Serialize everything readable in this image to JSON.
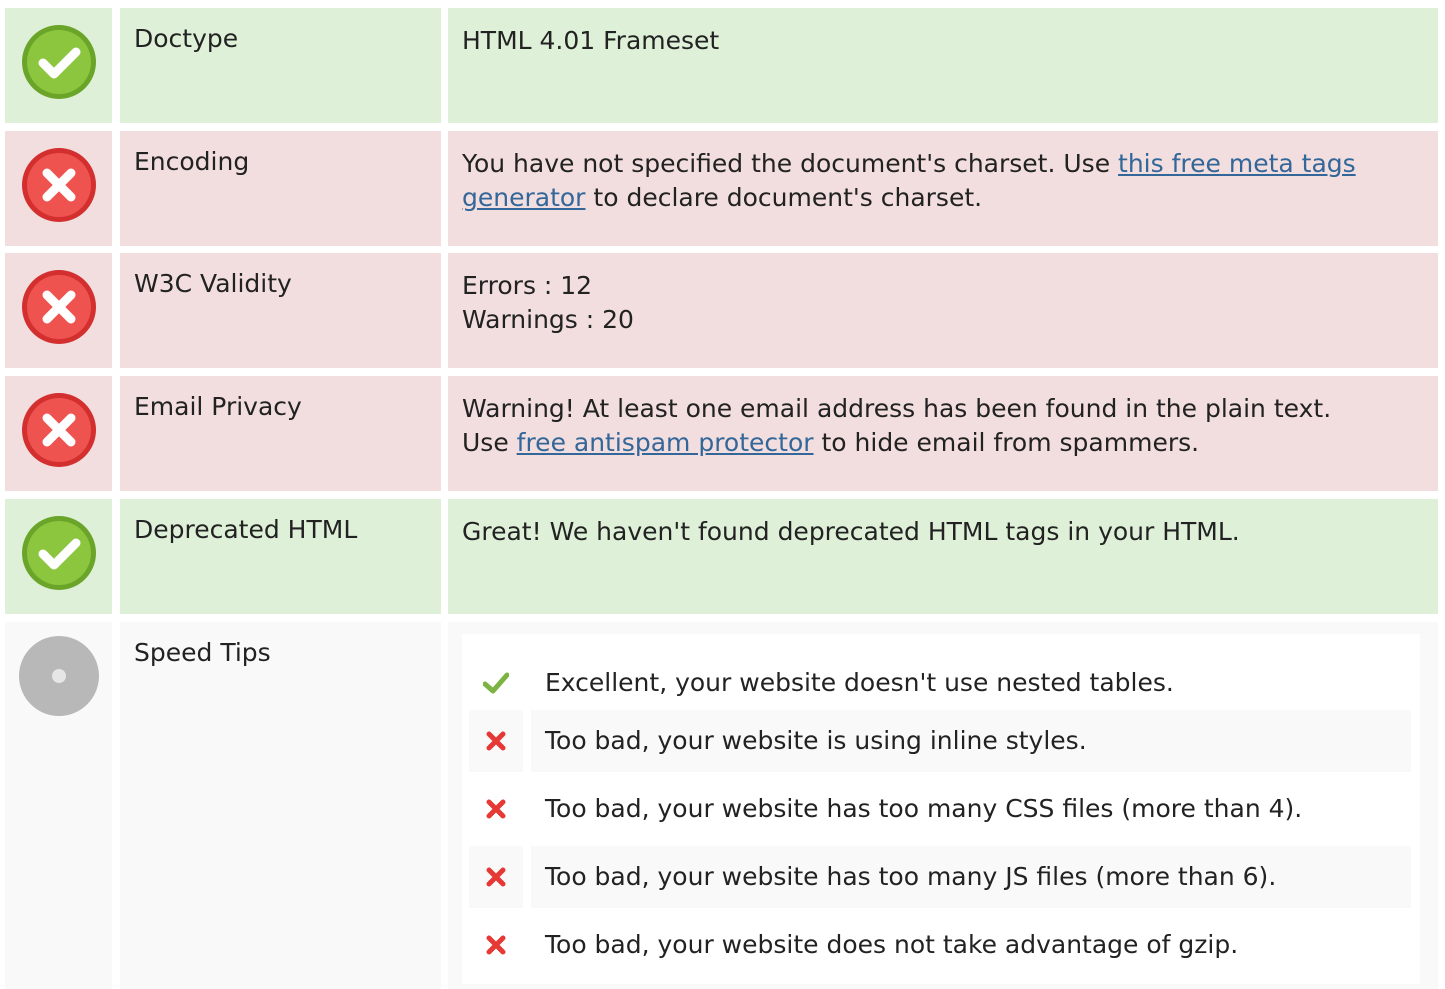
{
  "rows": [
    {
      "status": "pass",
      "label": "Doctype",
      "value": "HTML 4.01 Frameset"
    },
    {
      "status": "fail",
      "label": "Encoding",
      "value_before": "You have not specified the document's charset. Use ",
      "link": "this free meta tags generator",
      "value_after": " to declare document's charset."
    },
    {
      "status": "fail",
      "label": "W3C Validity",
      "line1": "Errors : 12",
      "line2": "Warnings : 20"
    },
    {
      "status": "fail",
      "label": "Email Privacy",
      "line1": "Warning! At least one email address has been found in the plain text.",
      "line2_before": "Use ",
      "link": "free antispam protector",
      "line2_after": " to hide email from spammers."
    },
    {
      "status": "pass",
      "label": "Deprecated HTML",
      "value": "Great! We haven't found deprecated HTML tags in your HTML."
    },
    {
      "status": "info",
      "label": "Speed Tips"
    }
  ],
  "speed_tips": [
    {
      "result": "pass",
      "text": "Excellent, your website doesn't use nested tables."
    },
    {
      "result": "fail",
      "text": "Too bad, your website is using inline styles."
    },
    {
      "result": "fail",
      "text": "Too bad, your website has too many CSS files (more than 4)."
    },
    {
      "result": "fail",
      "text": "Too bad, your website has too many JS files (more than 6)."
    },
    {
      "result": "fail",
      "text": "Too bad, your website does not take advantage of gzip."
    }
  ],
  "colors": {
    "pass_bg": "#dff0d8",
    "fail_bg": "#f2dede",
    "info_bg": "#f9f9f9",
    "link": "#336699",
    "check": "#7cb342",
    "cross": "#e53935"
  },
  "icons": {
    "pass": "check-circle-icon",
    "fail": "x-circle-icon",
    "info": "info-circle-icon",
    "tip_pass": "checkmark-icon",
    "tip_fail": "cross-icon"
  }
}
